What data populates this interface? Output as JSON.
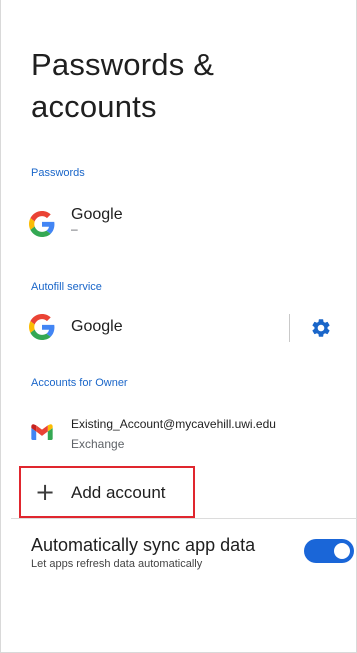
{
  "page": {
    "title": "Passwords & accounts"
  },
  "passwords": {
    "header": "Passwords",
    "provider": {
      "name": "Google",
      "summary": "–",
      "icon": "google-g-icon"
    }
  },
  "autofill": {
    "header": "Autofill service",
    "provider": {
      "name": "Google",
      "icon": "google-g-icon"
    },
    "settings_icon": "gear-icon"
  },
  "accounts": {
    "header": "Accounts for Owner",
    "items": [
      {
        "email": "Existing_Account@mycavehill.uwi.edu",
        "type": "Exchange",
        "icon": "gmail-icon"
      }
    ],
    "add": {
      "label": "Add account",
      "icon": "plus-icon"
    }
  },
  "sync": {
    "title": "Automatically sync app data",
    "summary": "Let apps refresh data automatically",
    "enabled": true
  },
  "colors": {
    "accent": "#1a66c9",
    "highlight": "#e0262e",
    "toggle_on": "#1a66d8"
  }
}
